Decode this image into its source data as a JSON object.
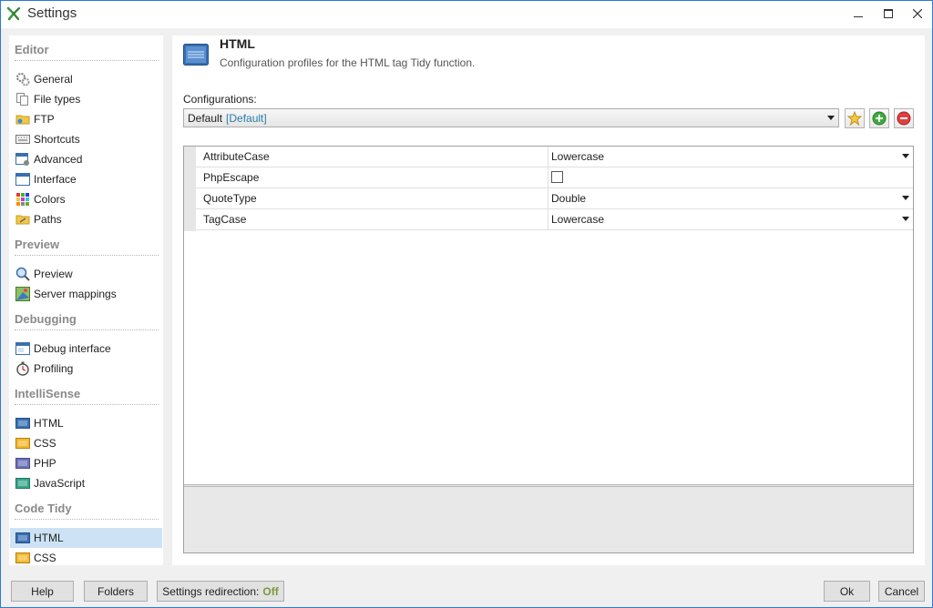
{
  "window": {
    "title": "Settings"
  },
  "sidebar": {
    "groups": [
      {
        "title": "Editor",
        "items": [
          {
            "label": "General",
            "icon": "gears-icon"
          },
          {
            "label": "File types",
            "icon": "files-icon"
          },
          {
            "label": "FTP",
            "icon": "folder-ftp-icon"
          },
          {
            "label": "Shortcuts",
            "icon": "keyboard-icon"
          },
          {
            "label": "Advanced",
            "icon": "advanced-icon"
          },
          {
            "label": "Interface",
            "icon": "window-icon"
          },
          {
            "label": "Colors",
            "icon": "palette-icon"
          },
          {
            "label": "Paths",
            "icon": "folder-path-icon"
          }
        ]
      },
      {
        "title": "Preview",
        "items": [
          {
            "label": "Preview",
            "icon": "magnifier-icon"
          },
          {
            "label": "Server mappings",
            "icon": "map-icon"
          }
        ]
      },
      {
        "title": "Debugging",
        "items": [
          {
            "label": "Debug interface",
            "icon": "window-icon"
          },
          {
            "label": "Profiling",
            "icon": "stopwatch-icon"
          }
        ]
      },
      {
        "title": "IntelliSense",
        "items": [
          {
            "label": "HTML",
            "icon": "html-icon"
          },
          {
            "label": "CSS",
            "icon": "css-icon"
          },
          {
            "label": "PHP",
            "icon": "php-icon"
          },
          {
            "label": "JavaScript",
            "icon": "js-icon"
          }
        ]
      },
      {
        "title": "Code Tidy",
        "items": [
          {
            "label": "HTML",
            "icon": "html-icon",
            "selected": true
          },
          {
            "label": "CSS",
            "icon": "css-icon"
          }
        ]
      }
    ]
  },
  "main": {
    "title": "HTML",
    "subtitle": "Configuration profiles for the HTML tag Tidy function.",
    "config_label": "Configurations:",
    "config_value": "Default",
    "config_tag": "[Default]",
    "properties": [
      {
        "name": "AttributeCase",
        "value": "Lowercase",
        "type": "dropdown"
      },
      {
        "name": "PhpEscape",
        "value": "",
        "type": "checkbox",
        "checked": false
      },
      {
        "name": "QuoteType",
        "value": "Double",
        "type": "dropdown"
      },
      {
        "name": "TagCase",
        "value": "Lowercase",
        "type": "dropdown"
      }
    ]
  },
  "footer": {
    "help": "Help",
    "folders": "Folders",
    "redirection_label": "Settings redirection:",
    "redirection_value": "Off",
    "ok": "Ok",
    "cancel": "Cancel"
  },
  "colors": {
    "accent": "#2b79d8",
    "selection": "#cde3f5",
    "tag_text": "#2a7ea8",
    "off_text": "#7a9a3a"
  }
}
